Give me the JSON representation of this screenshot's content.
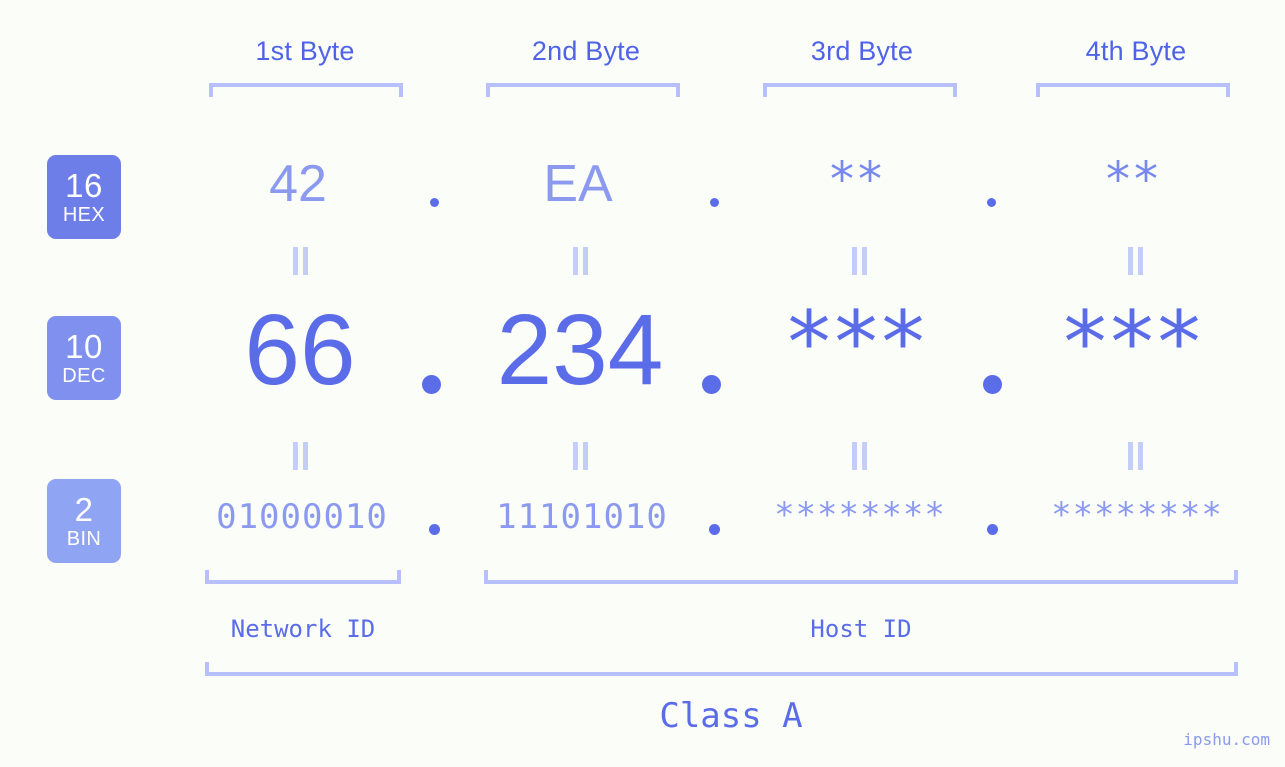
{
  "meta": {
    "watermark": "ipshu.com",
    "background_color": "#fbfdf8",
    "accent_color": "#5b6ce8",
    "light_accent_color": "#8b9af0",
    "bracket_color": "#b7c0fb"
  },
  "byte_headers": [
    {
      "label": "1st Byte"
    },
    {
      "label": "2nd Byte"
    },
    {
      "label": "3rd Byte"
    },
    {
      "label": "4th Byte"
    }
  ],
  "bases": [
    {
      "number": "16",
      "name": "HEX",
      "color": "#6d7ee8"
    },
    {
      "number": "10",
      "name": "DEC",
      "color": "#8090ee"
    },
    {
      "number": "2",
      "name": "BIN",
      "color": "#8fa4f2"
    }
  ],
  "rows": {
    "hex": {
      "values": [
        "42",
        "EA",
        "**",
        "**"
      ],
      "separator": "."
    },
    "dec": {
      "values": [
        "66",
        "234",
        "***",
        "***"
      ],
      "separator": "."
    },
    "bin": {
      "values": [
        "01000010",
        "11101010",
        "********",
        "********"
      ],
      "separator": "."
    }
  },
  "equality_symbol": "||",
  "segments": {
    "network_id": "Network ID",
    "host_id": "Host ID",
    "class": "Class A"
  }
}
